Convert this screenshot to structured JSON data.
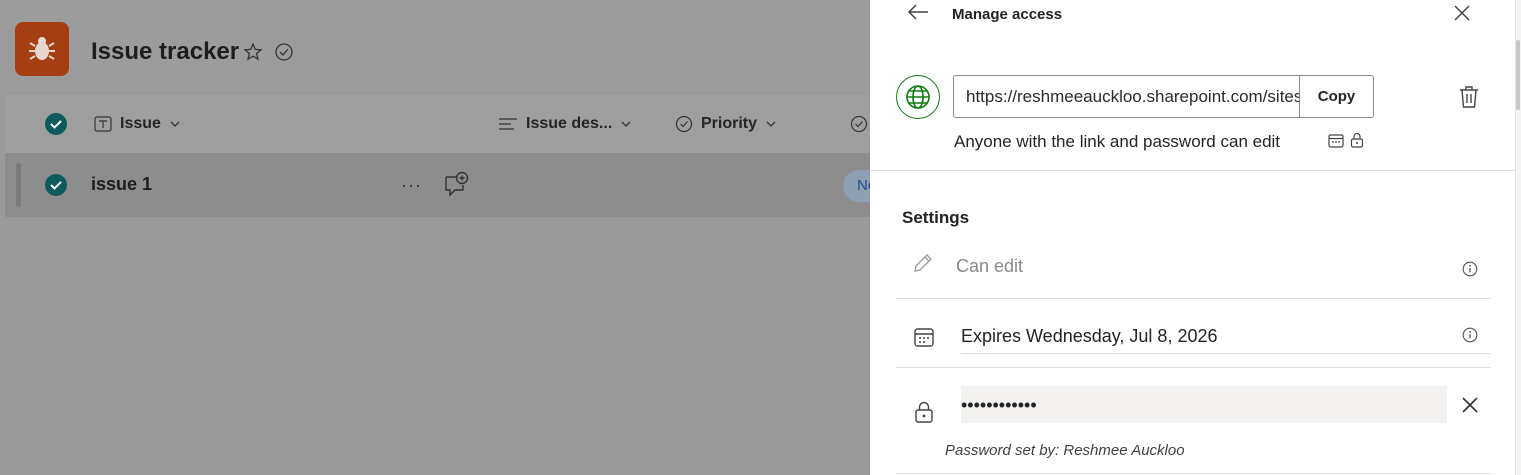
{
  "app": {
    "title": "Issue tracker",
    "columns": [
      {
        "label": "Issue"
      },
      {
        "label": "Issue des..."
      },
      {
        "label": "Priority"
      }
    ],
    "rows": [
      {
        "title": "issue 1",
        "status_pill": "Ne",
        "more": "···"
      }
    ],
    "brand_color": "#a63e14"
  },
  "panel": {
    "title": "Manage access",
    "link_url": "https://reshmeeauckloo.sharepoint.com/sites/...",
    "copy_label": "Copy",
    "link_description": "Anyone with the link and password can edit",
    "settings_heading": "Settings",
    "permission_label": "Can edit",
    "expiry_label": "Expires Wednesday, Jul 8, 2026",
    "password_value": "••••••••••••",
    "password_note": "Password set by: Reshmee Auckloo",
    "accent_color": "#107c10"
  }
}
